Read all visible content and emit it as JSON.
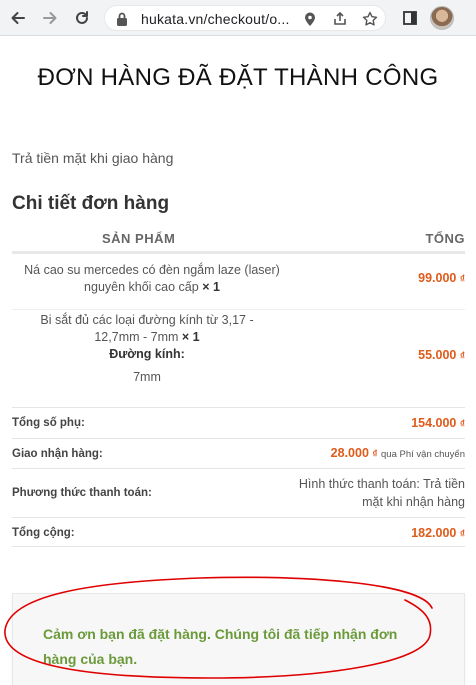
{
  "browser": {
    "url": "hukata.vn/checkout/o...",
    "icons": [
      "back-arrow-icon",
      "forward-arrow-icon",
      "reload-icon",
      "lock-icon",
      "location-pin-icon",
      "share-icon",
      "star-icon",
      "sidebar-icon",
      "avatar"
    ]
  },
  "page": {
    "title": "ĐƠN HÀNG ĐÃ ĐẶT THÀNH CÔNG",
    "payment_note": "Trả tiền mặt khi giao hàng",
    "section_title": "Chi tiết đơn hàng"
  },
  "table": {
    "header_product": "SẢN PHẨM",
    "header_total": "TỔNG",
    "items": [
      {
        "name_line1": "Ná cao su mercedes có đèn ngắm laze (laser)",
        "name_line2": "nguyên khối cao cấp",
        "qty": "× 1",
        "price": "99.000",
        "currency": "₫"
      },
      {
        "name_line1": "Bi sắt đủ các loại đường kính từ 3,17 -",
        "name_line2": "12,7mm - 7mm",
        "qty": "× 1",
        "meta_label": "Đường kính:",
        "meta_value": "7mm",
        "price": "55.000",
        "currency": "₫"
      }
    ]
  },
  "summary": {
    "subtotal_label": "Tổng số phụ:",
    "subtotal_value": "154.000",
    "shipping_label": "Giao nhận hàng:",
    "shipping_value": "28.000",
    "shipping_method": "qua Phí vận chuyển",
    "payment_label": "Phương thức thanh toán:",
    "payment_value": "Hình thức thanh toán: Trả tiền mặt khi nhận hàng",
    "total_label": "Tổng cộng:",
    "total_value": "182.000",
    "currency": "₫"
  },
  "thank_you": "Cảm ơn bạn đã đặt hàng. Chúng tôi đã tiếp nhận đơn hàng của bạn.",
  "colors": {
    "accent_price": "#e05a1a",
    "thank_text": "#6a9a3a",
    "annotation": "#e00000"
  }
}
